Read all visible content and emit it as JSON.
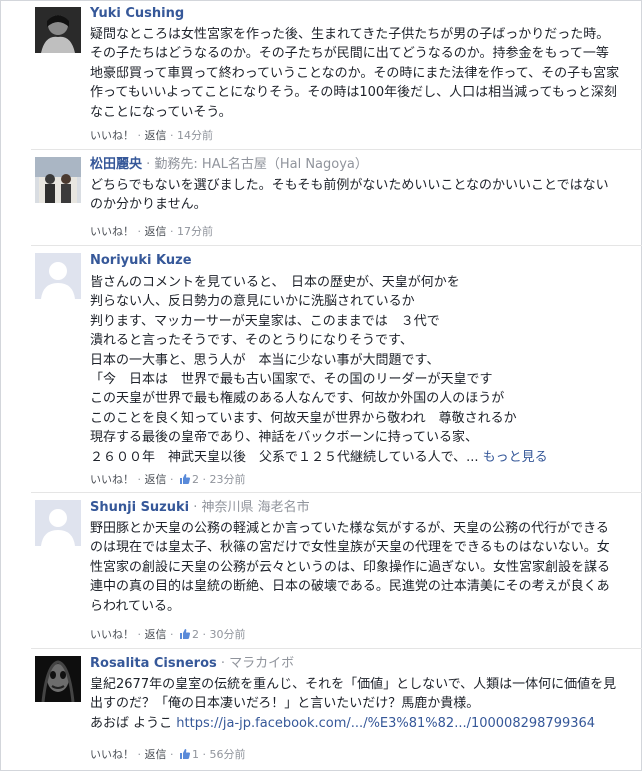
{
  "comments": [
    {
      "name": "Yuki Cushing",
      "affiliation": "",
      "text": "疑問なところは女性宮家を作った後、生まれてきた子供たちが男の子ばっかりだった時。その子たちはどうなるのか。その子たちが民間に出てどうなるのか。持参金をもって一等地豪邸買って車買って終わっていうことなのか。その時にまた法律を作って、その子も宮家作ってもいいよってことになりそう。その時は100年後だし、人口は相当減ってもっと深刻なことになっていそう。",
      "like": "いいね！",
      "reply": "返信",
      "like_count": "",
      "time": "14分前"
    },
    {
      "name": "松田麗央",
      "affiliation": "勤務先: HAL名古屋（Hal Nagoya）",
      "text": "どちらでもないを選びました。そもそも前例がないためいいことなのかいいことではないのか分かりません。",
      "like": "いいね！",
      "reply": "返信",
      "like_count": "",
      "time": "17分前"
    },
    {
      "name": "Noriyuki Kuze",
      "affiliation": "",
      "text": "皆さんのコメントを見ていると、　日本の歴史が、天皇が何かを\n判らない人、反日勢力の意見にいかに洗脳されているか\n判ります、マッカーサーが天皇家は、このままでは　３代で\n潰れると言ったそうです、そのとうりになりそうです、\n日本の一大事と、思う人が　本当に少ない事が大問題です、\n「今　日本は　世界で最も古い国家で、その国のリーダーが天皇です\nこの天皇が世界で最も権威のある人なんです、何故か外国の人のほうが\nこのことを良く知っています、何故天皇が世界から敬われ　尊敬されるか\n現存する最後の皇帝であり、神話をバックボーンに持っている家、\n２６００年　神武天皇以後　父系で１２５代継続している人で、...",
      "more": "もっと見る",
      "like": "いいね！",
      "reply": "返信",
      "like_count": "2",
      "time": "23分前"
    },
    {
      "name": "Shunji Suzuki",
      "affiliation": "神奈川県 海老名市",
      "text": "野田豚とか天皇の公務の軽減とか言っていた様な気がするが、天皇の公務の代行ができるのは現在では皇太子、秋篠の宮だけで女性皇族が天皇の代理をできるものはないない。女性宮家の創設に天皇の公務が云々というのは、印象操作に過ぎない。女性宮家創設を謀る連中の真の目的は皇統の断絶、日本の破壊である。民進党の辻本清美にその考えが良くあらわれている。",
      "like": "いいね！",
      "reply": "返信",
      "like_count": "2",
      "time": "30分前"
    },
    {
      "name": "Rosalita Cisneros",
      "affiliation": "マラカイボ",
      "text": "皇紀2677年の皇室の伝統を重んじ、それを「価値」としないで、人類は一体何に価値を見出すのだ？「俺の日本凄いだろ！」と言いたいだけ？馬鹿か貴様。",
      "text2": "あおば ようこ",
      "link": "https://ja-jp.facebook.com/.../%E3%81%82.../100008298799364",
      "like": "いいね！",
      "reply": "返信",
      "like_count": "1",
      "time": "56分前"
    }
  ],
  "colors": {
    "name": "#365899",
    "meta": "#90949c",
    "text": "#1d2129",
    "divider": "#e5e5e5"
  },
  "icons": [
    "avatar-yuki",
    "avatar-matsuda",
    "avatar-default",
    "avatar-default",
    "avatar-rosalita",
    "thumbs-up-icon"
  ]
}
